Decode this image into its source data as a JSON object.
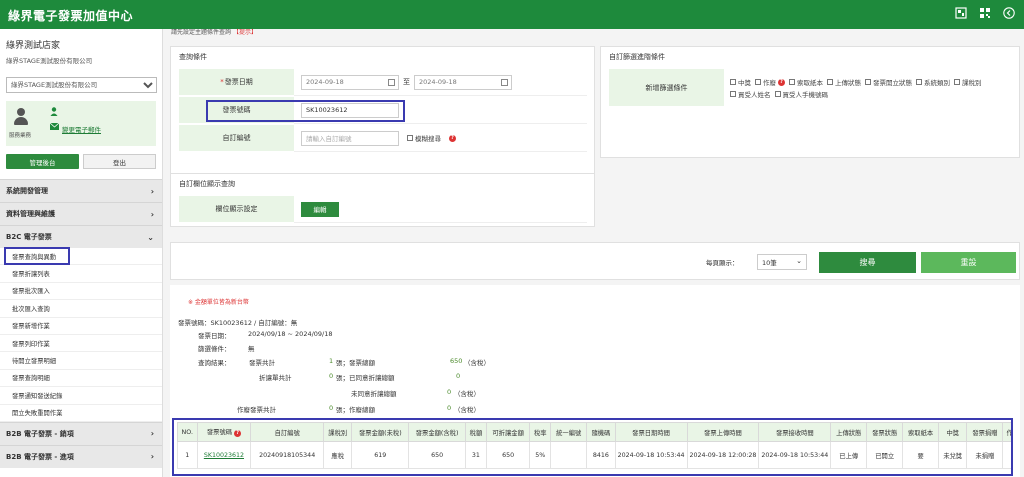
{
  "app": {
    "title": "綠界電子發票加值中心"
  },
  "sidebar": {
    "store_name": "綠界測試店家",
    "company": "綠界STAGE測試股份有限公司",
    "company_select": "綠界STAGE測試股份有限公司",
    "role": "服務業務",
    "email_link": "變更電子郵件",
    "manage_btn": "管理後台",
    "logout_btn": "登出",
    "menu": [
      {
        "label": "系統開發管理"
      },
      {
        "label": "資料管理與維護"
      },
      {
        "label": "B2C 電子發票"
      }
    ],
    "sub_items": [
      {
        "label": "發票查詢與異動"
      },
      {
        "label": "發票折讓列表"
      },
      {
        "label": "發票批次匯入"
      },
      {
        "label": "批次匯入查詢"
      },
      {
        "label": "發票新增作業"
      },
      {
        "label": "發票列印作業"
      },
      {
        "label": "待開立發票明細"
      },
      {
        "label": "發票查詢明細"
      },
      {
        "label": "發票通知發送紀錄"
      },
      {
        "label": "開立失敗重開作業"
      }
    ],
    "menu_after": [
      {
        "label": "B2B 電子發票 - 銷項"
      },
      {
        "label": "B2B 電子發票 - 進項"
      }
    ]
  },
  "breadcrumb": {
    "text": "請先設定主題條件查詢",
    "tag": "【提示】"
  },
  "query": {
    "title": "查詢條件",
    "date_label": "發票日期",
    "date_from": "2024-09-18",
    "date_sep": "至",
    "date_to": "2024-09-18",
    "inv_label": "發票號碼",
    "inv_value": "SK10023612",
    "custom_label": "自訂編號",
    "custom_placeholder": "請輸入自訂編號",
    "fuzzy_label": "模糊搜尋"
  },
  "filter": {
    "title": "自訂篩選進階條件",
    "label": "新增篩選條件",
    "options": [
      "中獎",
      "作廢",
      "索取紙本",
      "上傳狀態",
      "發票開立狀態",
      "系統類別",
      "課稅別",
      "買受人姓名",
      "買受人手機號碼"
    ]
  },
  "columns_panel": {
    "title": "自訂欄位顯示查詢",
    "label": "欄位顯示設定",
    "edit_btn": "編輯"
  },
  "actions": {
    "per_page_label": "每頁顯示：",
    "per_page_value": "10筆",
    "search_btn": "搜尋",
    "reset_btn": "重設"
  },
  "results": {
    "notice": "※ 金額單位皆為新台幣",
    "line1": "發票號碼：SK10023612 / 自訂編號：無",
    "date_label": "發票日期：",
    "date_value": "2024/09/18 ~ 2024/09/18",
    "filter_label": "篩選條件：",
    "filter_value": "無",
    "result_label": "查詢結果：",
    "stats": [
      {
        "k": "發票共計",
        "cnt": "1",
        "unit": "張；發票總額",
        "amt": "650",
        "tail": "（含稅）"
      },
      {
        "k": "折讓單共計",
        "cnt": "0",
        "unit": "張；已同意折讓總額",
        "amt": "0",
        "tail": "（含稅）"
      },
      {
        "k": "",
        "cnt": "",
        "unit": "未同意折讓總額",
        "amt": "0",
        "tail": "（含稅）"
      },
      {
        "k": "作廢發票共計",
        "cnt": "0",
        "unit": "張；作廢總額",
        "amt": "0",
        "tail": "（含稅）"
      }
    ]
  },
  "table": {
    "headers": [
      "NO.",
      "發票號碼",
      "自訂編號",
      "課稅別",
      "發票金額(未稅)",
      "發票金額(含稅)",
      "稅額",
      "可折讓金額",
      "稅率",
      "統一編號",
      "隨機碼",
      "發票日期時間",
      "發票上傳時間",
      "發票接收時間",
      "上傳狀態",
      "發票狀態",
      "索取紙本",
      "中獎",
      "發票捐贈",
      "作"
    ],
    "rows": [
      [
        "1",
        "SK10023612",
        "20240918105344",
        "應稅",
        "619",
        "650",
        "31",
        "650",
        "5%",
        "",
        "8416",
        "2024-09-18 10:53:44",
        "2024-09-18 12:00:28",
        "2024-09-18 10:53:44",
        "已上傳",
        "已開立",
        "要",
        "未兌獎",
        "未捐贈",
        ""
      ]
    ]
  }
}
